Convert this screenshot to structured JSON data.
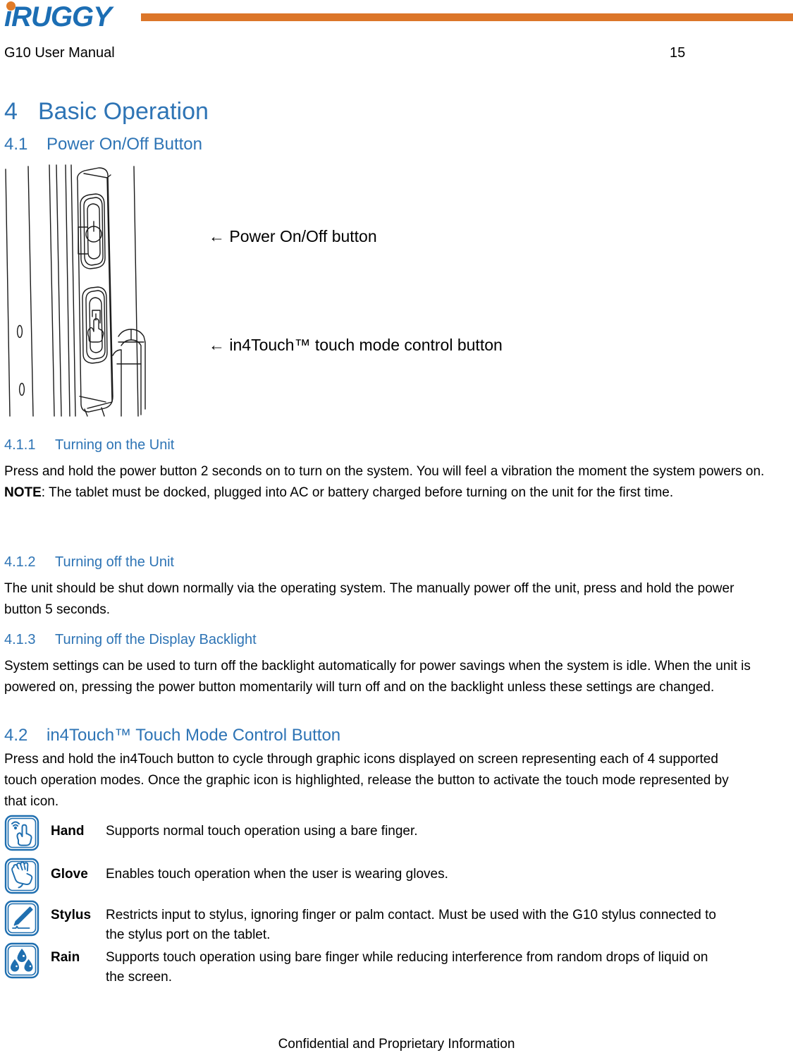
{
  "header": {
    "logo_text": "iRUGGY",
    "logo_i": "i",
    "logo_rest": "RUGGY",
    "title": "G10 User Manual",
    "page_number": "15",
    "accent_orange": "#DC7629",
    "accent_blue": "#1C6EB4"
  },
  "heading_color": "#2E74B5",
  "sections": {
    "s4": {
      "number": "4",
      "title": "Basic Operation"
    },
    "s41": {
      "number": "4.1",
      "title": "Power On/Off Button"
    },
    "s411": {
      "number": "4.1.1",
      "title": "Turning on the Unit",
      "body_1": "Press and hold the power button 2 seconds on to turn on the system.  You will feel a vibration the moment the system powers on.  ",
      "body_note_label": "NOTE",
      "body_2": ":  The tablet must be docked, plugged into AC or battery charged before turning on the unit for the first time."
    },
    "s412": {
      "number": "4.1.2",
      "title": "Turning off the Unit",
      "body": "The unit should be shut down normally via the operating system.  The manually power off the unit, press and hold the power button 5 seconds."
    },
    "s413": {
      "number": "4.1.3",
      "title": "Turning off the Display Backlight",
      "body": "System settings can be used to turn off the backlight automatically for power savings when the system is idle.  When the unit is powered on, pressing the power button momentarily will turn off and on the backlight unless these settings are changed."
    },
    "s42": {
      "number": "4.2",
      "title": "in4Touch™ Touch Mode Control Button",
      "body": "Press and hold the in4Touch button to cycle through graphic icons displayed on screen representing each of 4 supported touch operation modes.  Once the graphic icon is highlighted, release the button to activate the touch mode represented by that icon."
    }
  },
  "figure": {
    "name": "tablet-side-buttons-line-drawing",
    "callout_power": "← Power On/Off button",
    "callout_touch": "← in4Touch™ touch mode control button"
  },
  "touch_modes": [
    {
      "icon": "hand-touch-icon",
      "name": "Hand",
      "description": "Supports normal touch operation using a bare finger."
    },
    {
      "icon": "glove-icon",
      "name": "Glove",
      "description": "Enables touch operation when the user is wearing gloves."
    },
    {
      "icon": "stylus-icon",
      "name": "Stylus",
      "description": "Restricts input to stylus, ignoring finger or palm contact.   Must be used with the G10 stylus connected to the stylus port on the tablet."
    },
    {
      "icon": "rain-drops-icon",
      "name": "Rain",
      "description": "Supports touch operation using bare finger while reducing interference from random drops of liquid on the screen."
    }
  ],
  "footer": {
    "text": "Confidential and Proprietary Information"
  }
}
